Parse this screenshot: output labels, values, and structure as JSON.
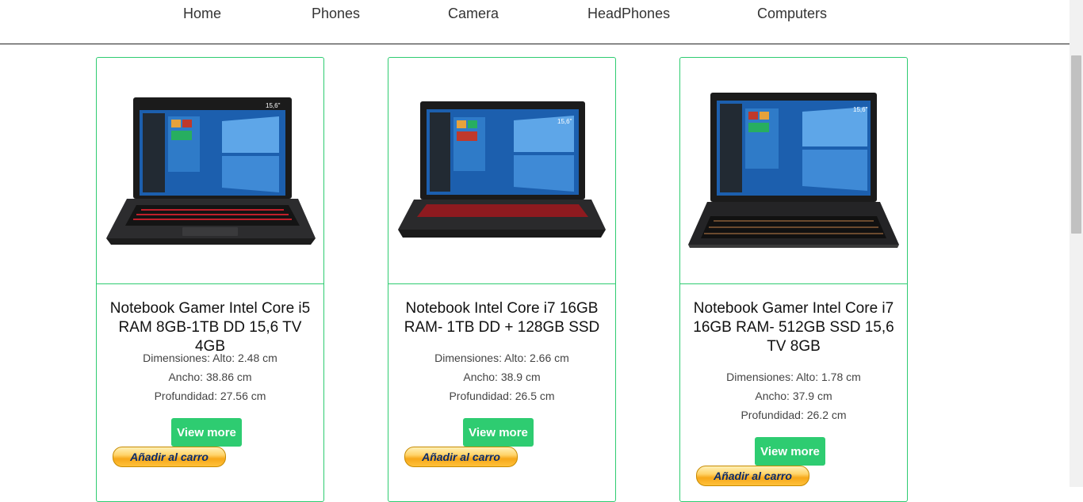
{
  "nav": {
    "items": [
      {
        "label": "Home"
      },
      {
        "label": "Phones"
      },
      {
        "label": "Camera"
      },
      {
        "label": "HeadPhones"
      },
      {
        "label": "Computers"
      }
    ]
  },
  "products": [
    {
      "title": "Notebook Gamer Intel Core i5 RAM 8GB-1TB DD 15,6 TV 4GB",
      "dims": [
        "Dimensiones: Alto: 2.48 cm",
        "Ancho: 38.86 cm",
        "Profundidad: 27.56 cm"
      ],
      "badge": "15,6\"",
      "view_label": "View more",
      "cart_label": "Añadir al carro"
    },
    {
      "title": "Notebook Intel Core i7 16GB RAM- 1TB DD + 128GB SSD",
      "dims": [
        "Dimensiones: Alto: 2.66 cm",
        "Ancho: 38.9 cm",
        "Profundidad: 26.5 cm"
      ],
      "badge": "15,6\"",
      "view_label": "View more",
      "cart_label": "Añadir al carro"
    },
    {
      "title": "Notebook Gamer Intel Core i7 16GB RAM- 512GB SSD 15,6 TV 8GB",
      "dims": [
        "Dimensiones: Alto: 1.78 cm",
        "Ancho: 37.9 cm",
        "Profundidad: 26.2 cm"
      ],
      "badge": "15,6\"",
      "view_label": "View more",
      "cart_label": "Añadir al carro"
    }
  ],
  "colors": {
    "accent_green": "#2ecc71",
    "cart_gold": "#ffc13a",
    "cart_text": "#0b2b6b",
    "keyboard_glow": "#c0202a"
  },
  "icons": [
    "laptop-image",
    "windows-logo-icon"
  ]
}
